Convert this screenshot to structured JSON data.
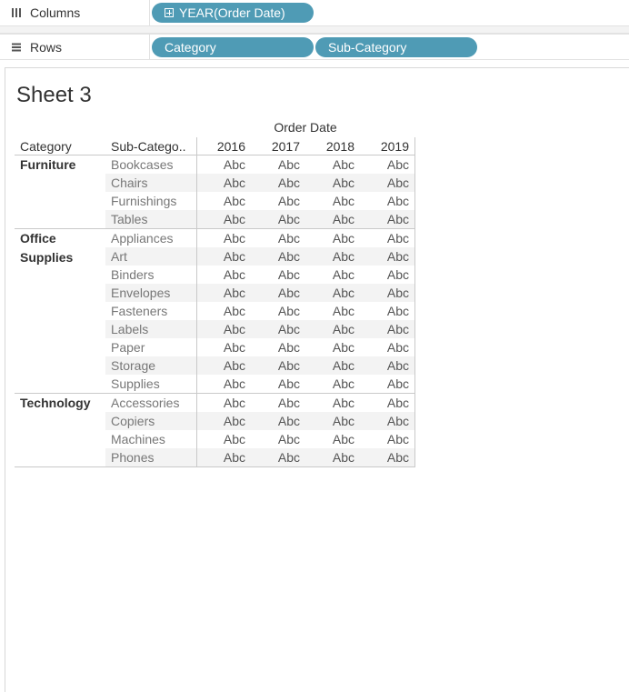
{
  "shelves": {
    "columns": {
      "label": "Columns",
      "icon": "columns-icon",
      "pills": [
        "YEAR(Order Date)"
      ]
    },
    "rows": {
      "label": "Rows",
      "icon": "rows-icon",
      "pills": [
        "Category",
        "Sub-Category"
      ]
    }
  },
  "sheet": {
    "title": "Sheet 3"
  },
  "crosstab": {
    "column_super_header": "Order Date",
    "headers": {
      "category": "Category",
      "sub_category": "Sub-Catego..",
      "years": [
        "2016",
        "2017",
        "2018",
        "2019"
      ]
    },
    "cell_text": "Abc",
    "groups": [
      {
        "category": "Furniture",
        "subcategories": [
          "Bookcases",
          "Chairs",
          "Furnishings",
          "Tables"
        ]
      },
      {
        "category": "Office Supplies",
        "subcategories": [
          "Appliances",
          "Art",
          "Binders",
          "Envelopes",
          "Fasteners",
          "Labels",
          "Paper",
          "Storage",
          "Supplies"
        ]
      },
      {
        "category": "Technology",
        "subcategories": [
          "Accessories",
          "Copiers",
          "Machines",
          "Phones"
        ]
      }
    ]
  },
  "colors": {
    "pill": "#4f9bb5",
    "band": "#f3f3f3"
  }
}
